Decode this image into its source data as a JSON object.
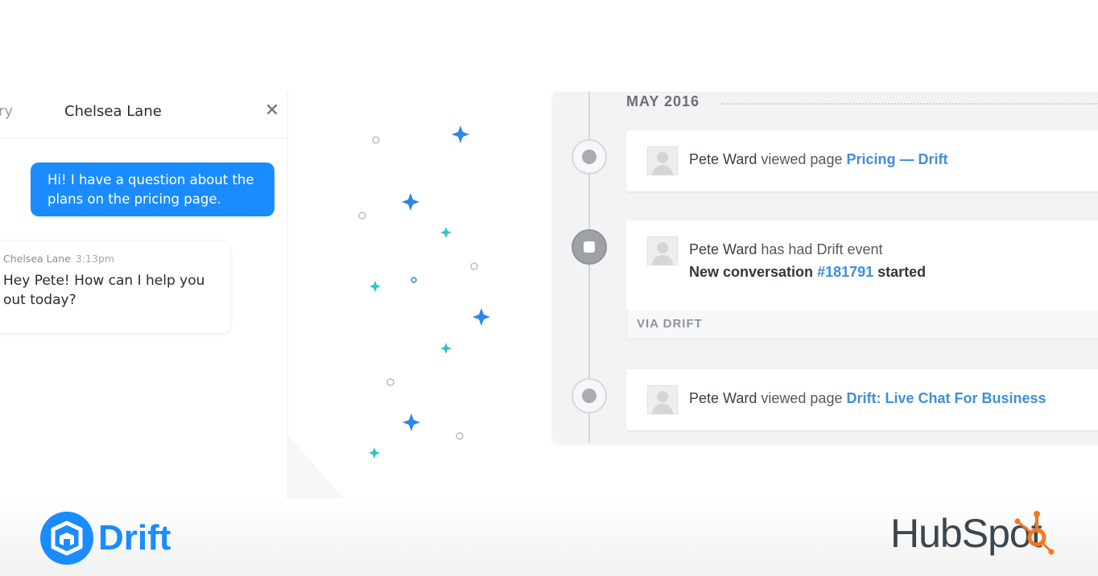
{
  "chat": {
    "back_fragment": "ry",
    "title": "Chelsea Lane",
    "close_glyph": "✕",
    "outgoing_message": "Hi! I have a question about the plans on  the pricing page.",
    "incoming": {
      "sender": "Chelsea Lane",
      "time": "3:13pm",
      "message": "Hey Pete! How can I help you out today?"
    }
  },
  "timeline": {
    "month": "MAY 2016",
    "events": [
      {
        "actor": "Pete Ward",
        "action": "viewed page",
        "link": "Pricing — Drift",
        "icon": "globe-icon"
      },
      {
        "actor": "Pete Ward",
        "action": "has had Drift event",
        "line2_prefix": "New conversation",
        "line2_link": "#181791",
        "line2_suffix": "started",
        "footer": "VIA DRIFT",
        "icon": "drift-event-icon"
      },
      {
        "actor": "Pete Ward",
        "action": "viewed page",
        "link": "Drift: Live Chat For Business",
        "icon": "globe-icon"
      }
    ]
  },
  "brands": {
    "left": "Drift",
    "right": "HubSpot"
  },
  "colors": {
    "drift_blue": "#1a8cff",
    "link_blue": "#3f8fd9",
    "hubspot_orange": "#f57722",
    "sparkle_blue": "#2f86ea",
    "sparkle_teal": "#2fc4c0"
  }
}
